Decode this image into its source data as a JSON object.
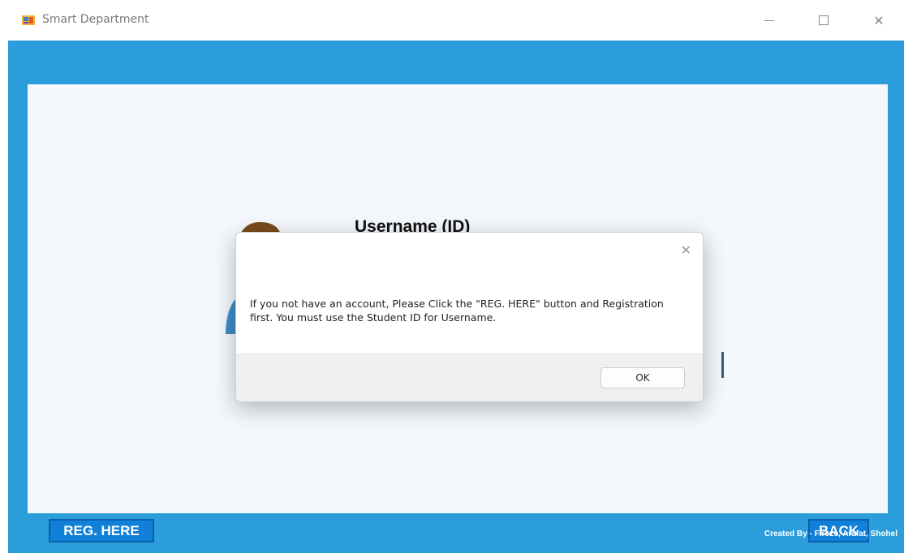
{
  "window": {
    "title": "Smart Department",
    "app_icon": "app-icon",
    "controls": [
      "minimize-icon",
      "maximize-icon",
      "close-icon"
    ]
  },
  "form": {
    "username_label": "Username (ID)",
    "avatar_icon": "users-avatar-icon"
  },
  "buttons": {
    "register_label": "REG. HERE",
    "back_label": "BACK"
  },
  "footer": {
    "credit": "Created By - Firoze, Arafat, Shohel"
  },
  "dialog": {
    "message": "If you not have an account, Please Click the \"REG. HERE\" button and Registration first. You must use the Student ID for Username.",
    "ok_label": "OK",
    "close_icon": "close-icon"
  },
  "colors": {
    "accent": "#2c9ddb",
    "button": "#1180d8",
    "panel": "#f4f8fc"
  }
}
